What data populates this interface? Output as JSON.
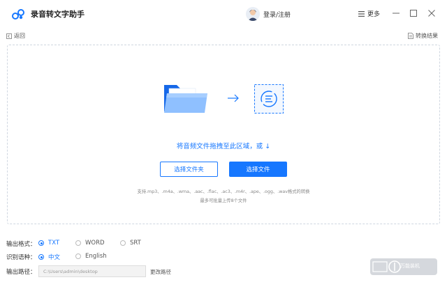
{
  "app": {
    "title": "录音转文字助手"
  },
  "header": {
    "login_label": "登录/注册",
    "more_label": "更多"
  },
  "nav": {
    "back_label": "返回",
    "result_label": "转换结果"
  },
  "dropzone": {
    "drop_text": "将音频文件拖拽至此区域，或 ↓",
    "select_folder_label": "选择文件夹",
    "select_file_label": "选择文件",
    "formats_text": "支持.mp3、.m4a、.wma、.aac、.flac、.ac3、.m4r、.ape、.ogg、.wav格式的转换",
    "limit_text": "最多可批量上传8个文件"
  },
  "options": {
    "output_format_label": "输出格式：",
    "formats": [
      {
        "label": "TXT",
        "checked": true
      },
      {
        "label": "WORD",
        "checked": false
      },
      {
        "label": "SRT",
        "checked": false
      }
    ],
    "language_label": "识别语种：",
    "languages": [
      {
        "label": "中文",
        "checked": true
      },
      {
        "label": "English",
        "checked": false
      }
    ],
    "path_label": "输出路径：",
    "path_value": "C:\\Users\\admin\\desktop",
    "change_path_label": "更改路径"
  },
  "watermark": {
    "text": "万能装机"
  },
  "colors": {
    "accent": "#1677ff",
    "border": "#cfd6e0"
  }
}
